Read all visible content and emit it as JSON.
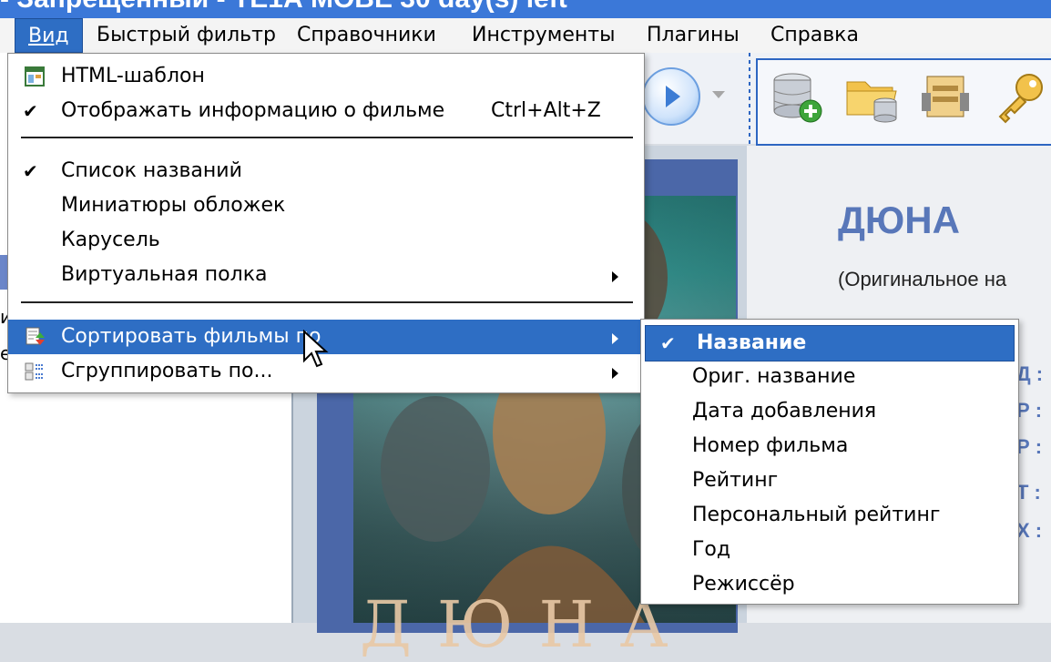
{
  "titlebar": {
    "text": "- Запрещённый - ТЁ1А МОВЕ 30 day(s) left"
  },
  "menubar": {
    "items": [
      {
        "label": "Вид"
      },
      {
        "label": "Быстрый фильтр"
      },
      {
        "label": "Справочники"
      },
      {
        "label": "Инструменты"
      },
      {
        "label": "Плагины"
      },
      {
        "label": "Справка"
      }
    ]
  },
  "view_menu": {
    "items": [
      {
        "label": "HTML-шаблон",
        "icon": "html-template-icon"
      },
      {
        "label": "Отображать информацию о фильме",
        "shortcut": "Ctrl+Alt+Z",
        "checked": true
      },
      {
        "label": "Список названий",
        "checked": true
      },
      {
        "label": "Миниатюры обложек"
      },
      {
        "label": "Карусель"
      },
      {
        "label": "Виртуальная полка",
        "submenu": true
      },
      {
        "label": "Сортировать фильмы по",
        "icon": "sort-icon",
        "submenu": true,
        "highlighted": true
      },
      {
        "label": "Сгруппировать по...",
        "icon": "group-icon",
        "submenu": true
      }
    ]
  },
  "sort_submenu": {
    "items": [
      {
        "label": "Название",
        "checked": true,
        "highlighted": true
      },
      {
        "label": "Ориг. название"
      },
      {
        "label": "Дата добавления"
      },
      {
        "label": "Номер фильма"
      },
      {
        "label": "Рейтинг"
      },
      {
        "label": "Персональный рейтинг"
      },
      {
        "label": "Год"
      },
      {
        "label": "Режиссёр"
      }
    ]
  },
  "movie": {
    "title": "ДЮНА",
    "original_name_partial": "(Оригинальное на",
    "field_labels": [
      "Д :",
      "Р :",
      "Р :",
      "Т :",
      "Х :"
    ],
    "cover_text": "ДЮНА"
  },
  "left_panel": {
    "fragment_1": "и",
    "fragment_2": "е"
  },
  "colors": {
    "accent": "#2e6ec4",
    "title_blue": "#5877b9",
    "toolbar_blue": "#2d66c2"
  }
}
